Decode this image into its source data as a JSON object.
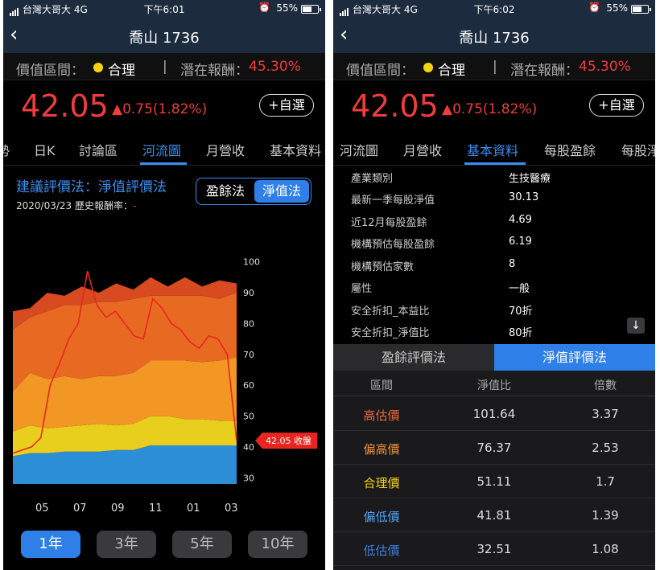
{
  "status": {
    "carrier": "台灣大哥大 4G",
    "time_left": "下午6:01",
    "time_right": "下午6:02",
    "alarm_icon": "alarm-clock-icon",
    "battery": "55%"
  },
  "nav": {
    "title": "喬山 1736",
    "back_icon": "chevron-left-icon"
  },
  "valuation": {
    "label": "價值區間：",
    "status": "合理",
    "status_color": "#f5d311",
    "separator": "|",
    "return_label": "潛在報酬：",
    "return_value": "45.30%"
  },
  "quote": {
    "price": "42.05",
    "change": "▲0.75(1.82%)",
    "favorite": "+自選",
    "up_color": "#f03c3c"
  },
  "tabs_left": [
    "勢",
    "日K",
    "討論區",
    "河流圖",
    "月營收",
    "基本資料"
  ],
  "tabs_left_active": "河流圖",
  "tabs_right": [
    "河流圖",
    "月營收",
    "基本資料",
    "每股盈餘",
    "每股淨"
  ],
  "tabs_right_active": "基本資料",
  "method": {
    "title": "建議評價法：淨值評價法",
    "date_label": "2020/03/23 歷史報酬率：",
    "date_value": "-",
    "opt_eps": "盈餘法",
    "opt_nav": "淨值法"
  },
  "ranges": [
    "1年",
    "3年",
    "5年",
    "10年"
  ],
  "ranges_active": "1年",
  "chart_data": {
    "type": "area",
    "x_labels": [
      "05",
      "07",
      "09",
      "11",
      "01",
      "03"
    ],
    "y_ticks": [
      100,
      90,
      80,
      70,
      60,
      50,
      40,
      30
    ],
    "ylim": [
      28,
      102
    ],
    "close_label": "42.05 收盤",
    "bands": [
      {
        "name": "低估價",
        "color": "#2b8ed6"
      },
      {
        "name": "偏低價",
        "color": "#e9cf1d"
      },
      {
        "name": "合理價",
        "color": "#f29624"
      },
      {
        "name": "偏高價",
        "color": "#e86a22"
      },
      {
        "name": "高估價",
        "color": "#d84a1f"
      }
    ],
    "band_bounds": {
      "b0": [
        28,
        28,
        28,
        28,
        28,
        28,
        28,
        28,
        28,
        28,
        28,
        28,
        28,
        28
      ],
      "b1": [
        37,
        38,
        38,
        38.5,
        38.5,
        38.5,
        39,
        39,
        40.5,
        40.5,
        40.5,
        40.5,
        40.5,
        40.5
      ],
      "b2": [
        45,
        47,
        46,
        46.5,
        47,
        47.5,
        47,
        47.5,
        50,
        50,
        49,
        49,
        48.5,
        48.5
      ],
      "b3": [
        58,
        64,
        62,
        63,
        62,
        63,
        63,
        64,
        68,
        68,
        68,
        67.5,
        68,
        69
      ],
      "b4": [
        78,
        82,
        84,
        86,
        86,
        87,
        87,
        88,
        89,
        89,
        89,
        89,
        88,
        90
      ]
    },
    "price_series": [
      38,
      39,
      40,
      43,
      60,
      67,
      75,
      80,
      97,
      86,
      82,
      84,
      80,
      76,
      75,
      88,
      85,
      80,
      78,
      74,
      72,
      76,
      75,
      70,
      42
    ]
  },
  "basic_info": [
    {
      "k": "產業類別",
      "v": "生技醫療"
    },
    {
      "k": "最新一季每股淨值",
      "v": "30.13"
    },
    {
      "k": "近12月每股盈餘",
      "v": "4.69"
    },
    {
      "k": "機構預估每股盈餘",
      "v": "6.19"
    },
    {
      "k": "機構預估家數",
      "v": "8"
    },
    {
      "k": "屬性",
      "v": "一般"
    },
    {
      "k": "安全折扣_本益比",
      "v": "70折"
    },
    {
      "k": "安全折扣_淨值比",
      "v": "80折"
    }
  ],
  "download_icon": "arrow-down-icon",
  "method_tabs": {
    "eps": "盈餘評價法",
    "nav": "淨值評價法"
  },
  "value_table": {
    "headers": [
      "區間",
      "淨值比",
      "倍數"
    ],
    "rows": [
      {
        "name": "高估價",
        "pb": "101.64",
        "mult": "3.37",
        "color": "#e8683a"
      },
      {
        "name": "偏高價",
        "pb": "76.37",
        "mult": "2.53",
        "color": "#f0903a"
      },
      {
        "name": "合理價",
        "pb": "51.11",
        "mult": "1.7",
        "color": "#f5d311"
      },
      {
        "name": "偏低價",
        "pb": "41.81",
        "mult": "1.39",
        "color": "#4ea3f0"
      },
      {
        "name": "低估價",
        "pb": "32.51",
        "mult": "1.08",
        "color": "#3b7fe0"
      }
    ]
  }
}
